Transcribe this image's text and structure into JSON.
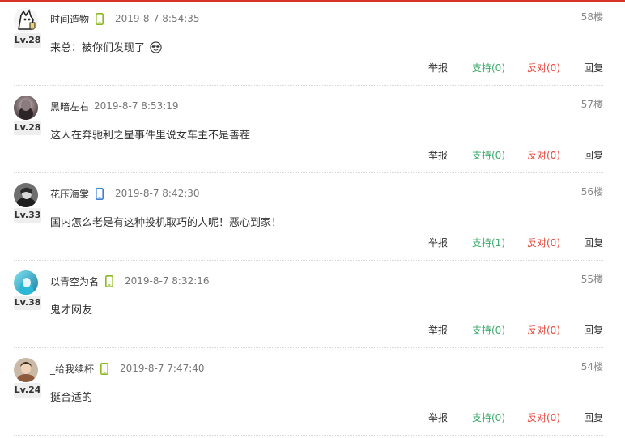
{
  "comments": [
    {
      "username": "时间造物",
      "level": "Lv.28",
      "time": "2019-8-7 8:54:35",
      "floor": "58楼",
      "content": "来总：被你们发现了",
      "emoji": "smiling-face-with-sunglasses",
      "device": "phone-icon-green",
      "report": "举报",
      "support": "支持(0)",
      "oppose": "反对(0)",
      "reply": "回复"
    },
    {
      "username": "黑暗左右",
      "level": "Lv.28",
      "time": "2019-8-7 8:53:19",
      "floor": "57楼",
      "content": "这人在奔驰利之星事件里说女车主不是善茬",
      "device": "",
      "report": "举报",
      "support": "支持(0)",
      "oppose": "反对(0)",
      "reply": "回复"
    },
    {
      "username": "花压海棠",
      "level": "Lv.33",
      "time": "2019-8-7 8:42:30",
      "floor": "56楼",
      "content": "国内怎么老是有这种投机取巧的人呢！恶心到家！",
      "device": "phone-icon-blue",
      "report": "举报",
      "support": "支持(1)",
      "oppose": "反对(0)",
      "reply": "回复"
    },
    {
      "username": "以青空为名",
      "level": "Lv.38",
      "time": "2019-8-7 8:32:16",
      "floor": "55楼",
      "content": "鬼才网友",
      "device": "phone-icon-green",
      "report": "举报",
      "support": "支持(0)",
      "oppose": "反对(0)",
      "reply": "回复"
    },
    {
      "username": "_给我续杯",
      "level": "Lv.24",
      "time": "2019-8-7 7:47:40",
      "floor": "54楼",
      "content": "挺合适的",
      "device": "phone-icon-green",
      "report": "举报",
      "support": "支持(0)",
      "oppose": "反对(0)",
      "reply": "回复"
    }
  ],
  "colors": {
    "accent_top_line": "#d9322a",
    "support": "#3bab6a",
    "oppose": "#e5483f",
    "phone_green": "#8bb81f",
    "phone_blue": "#3d7fd1"
  }
}
